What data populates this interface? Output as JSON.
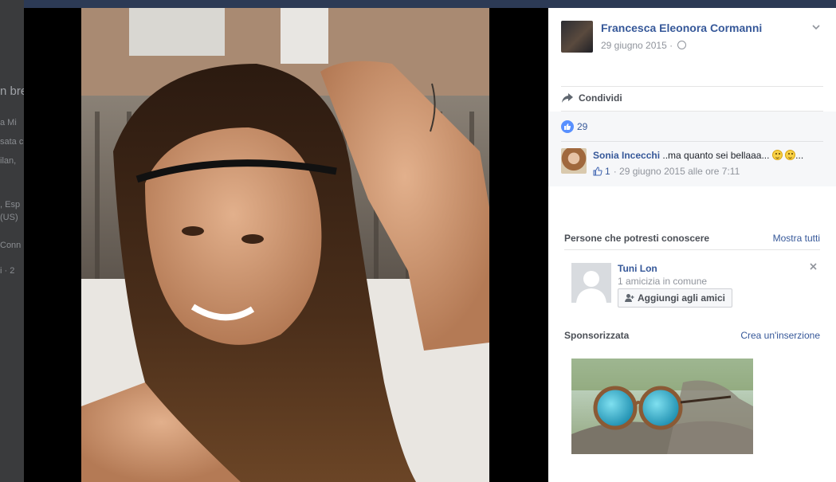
{
  "background_page": {
    "fragments": [
      "n bre",
      "a Mi",
      "sata c",
      "ilan,",
      ", Esp",
      "(US)",
      "Conn",
      "i · 2"
    ]
  },
  "post": {
    "author": "Francesca Eleonora Cormanni",
    "date": "29 giugno 2015",
    "audience_icon": "globe-icon",
    "menu_icon": "chevron-down-icon",
    "share_label": "Condividi",
    "likes_count": "29"
  },
  "comment": {
    "author": "Sonia Incecchi",
    "text": "..ma quanto sei bellaaa...",
    "trailing": "...",
    "likes": "1",
    "meta": "· 29 giugno 2015 alle ore 7:11"
  },
  "people_you_may_know": {
    "title": "Persone che potresti conoscere",
    "see_all": "Mostra tutti",
    "person": {
      "name": "Tuni Lon",
      "mutual": "1 amicizia in comune",
      "add_label": "Aggiungi agli amici"
    }
  },
  "sponsored": {
    "title": "Sponsorizzata",
    "create_ad": "Crea un'inserzione"
  },
  "colors": {
    "link": "#365899",
    "like_blue": "#5890ff",
    "ufi_bg": "#f6f7f9"
  }
}
